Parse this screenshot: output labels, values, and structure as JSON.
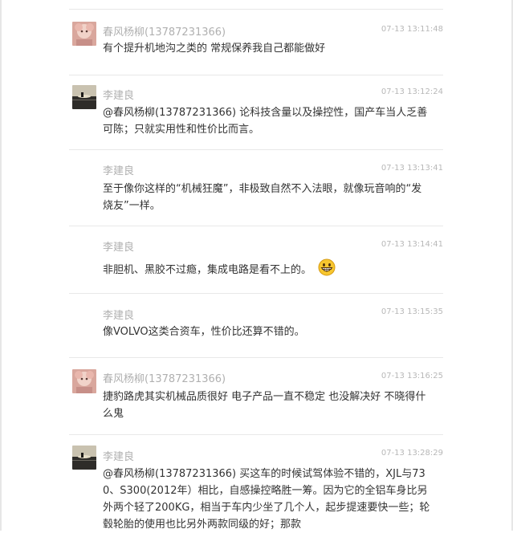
{
  "comments": [
    {
      "author": "春风杨柳(13787231366)",
      "time": "07-13 13:11:48",
      "content": "有个提升机地沟之类的 常规保养我自己都能做好",
      "avatar": "pink-doll-avatar"
    },
    {
      "author": "李建良",
      "time": "07-13 13:12:24",
      "content": "@春风杨柳(13787231366) 论科技含量以及操控性，国产车当人乏善可陈；只就实用性和性价比而言。",
      "avatar": "sunset-lake-avatar"
    },
    {
      "author": "李建良",
      "time": "07-13 13:13:41",
      "content": "至于像你这样的“机械狂魔”，非极致自然不入法眼，就像玩音响的“发烧友”一样。"
    },
    {
      "author": "李建良",
      "time": "07-13 13:14:41",
      "content": "非胆机、黑胶不过瘾，集成电路是看不上的。",
      "emoji": "grinning-face-icon"
    },
    {
      "author": "李建良",
      "time": "07-13 13:15:35",
      "content": "像VOLVO这类合资车，性价比还算不错的。"
    },
    {
      "author": "春风杨柳(13787231366)",
      "time": "07-13 13:16:25",
      "content": "捷豹路虎其实机械品质很好 电子产品一直不稳定 也没解决好 不晓得什么鬼",
      "avatar": "pink-doll-avatar"
    },
    {
      "author": "李建良",
      "time": "07-13 13:28:29",
      "content": "@春风杨柳(13787231366) 买这车的时候试驾体验不错的，XJL与730、S300(2012年）相比，自感操控略胜一筹。因为它的全铝车身比另外两个轻了200KG，相当于车内少坐了几个人，起步提速要快一些；轮毂轮胎的使用也比另外两款同级的好；那款",
      "avatar": "sunset-lake-avatar"
    }
  ]
}
